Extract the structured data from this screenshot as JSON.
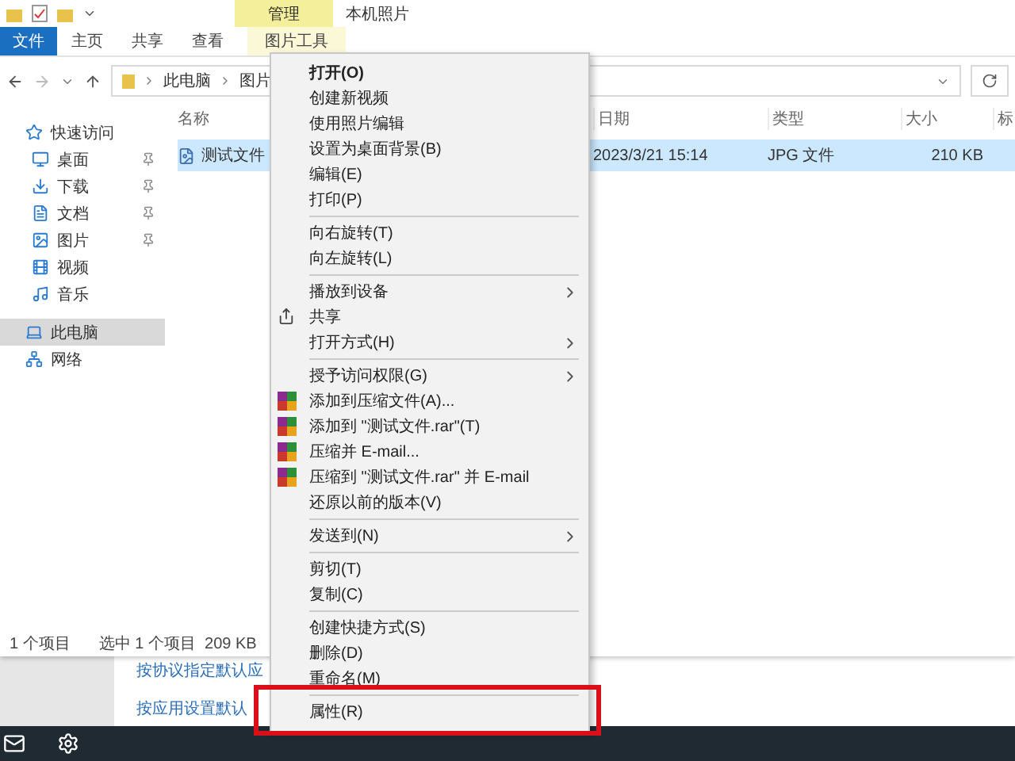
{
  "title_bar": {
    "context_tab": "管理",
    "title": "本机照片"
  },
  "ribbon_tabs": [
    {
      "label": "文件",
      "kind": "file"
    },
    {
      "label": "主页",
      "kind": "tab"
    },
    {
      "label": "共享",
      "kind": "tab"
    },
    {
      "label": "查看",
      "kind": "tab"
    },
    {
      "label": "图片工具",
      "kind": "context"
    }
  ],
  "address_bar": {
    "breadcrumb": [
      "此电脑",
      "图片"
    ]
  },
  "sidebar": {
    "items": [
      {
        "label": "快速访问",
        "kind": "star",
        "selected": false,
        "children": [
          {
            "label": "桌面",
            "kind": "desktop",
            "pinned": true,
            "selected": false
          },
          {
            "label": "下载",
            "kind": "download",
            "pinned": true,
            "selected": false
          },
          {
            "label": "文档",
            "kind": "documents",
            "pinned": true,
            "selected": false
          },
          {
            "label": "图片",
            "kind": "pictures",
            "pinned": true,
            "selected": false
          },
          {
            "label": "视频",
            "kind": "videos",
            "pinned": false,
            "selected": false
          },
          {
            "label": "音乐",
            "kind": "music",
            "pinned": false,
            "selected": false
          }
        ]
      },
      {
        "label": "此电脑",
        "kind": "pc",
        "selected": true
      },
      {
        "label": "网络",
        "kind": "network",
        "selected": false
      }
    ]
  },
  "table": {
    "columns": [
      "名称",
      "日期",
      "类型",
      "大小",
      "标"
    ],
    "rows": [
      {
        "name": "测试文件",
        "date": "2023/3/21 15:14",
        "type": "JPG 文件",
        "size": "210 KB",
        "selected": true
      }
    ]
  },
  "status_bar": {
    "count": "1 个项目",
    "selection": "选中 1 个项目  209 KB"
  },
  "background_links": [
    "按协议指定默认应",
    "按应用设置默认"
  ],
  "context_menu": {
    "groups": [
      [
        {
          "label": "打开(O)",
          "kind": "plain",
          "bold": true
        },
        {
          "label": "创建新视频",
          "kind": "plain",
          "bold": false
        },
        {
          "label": "使用照片编辑",
          "kind": "plain",
          "bold": false
        },
        {
          "label": "设置为桌面背景(B)",
          "kind": "plain",
          "bold": false
        },
        {
          "label": "编辑(E)",
          "kind": "plain",
          "bold": false
        },
        {
          "label": "打印(P)",
          "kind": "plain",
          "bold": false
        }
      ],
      [
        {
          "label": "向右旋转(T)",
          "kind": "plain",
          "bold": false
        },
        {
          "label": "向左旋转(L)",
          "kind": "plain",
          "bold": false
        }
      ],
      [
        {
          "label": "播放到设备",
          "kind": "submenu",
          "bold": false
        },
        {
          "label": "共享",
          "kind": "share",
          "bold": false
        },
        {
          "label": "打开方式(H)",
          "kind": "submenu",
          "bold": false
        }
      ],
      [
        {
          "label": "授予访问权限(G)",
          "kind": "submenu",
          "bold": false
        },
        {
          "label": "添加到压缩文件(A)...",
          "kind": "archive",
          "bold": false
        },
        {
          "label": "添加到 \"测试文件.rar\"(T)",
          "kind": "archive",
          "bold": false
        },
        {
          "label": "压缩并 E-mail...",
          "kind": "archive",
          "bold": false
        },
        {
          "label": "压缩到 \"测试文件.rar\" 并 E-mail",
          "kind": "archive",
          "bold": false
        },
        {
          "label": "还原以前的版本(V)",
          "kind": "plain",
          "bold": false
        }
      ],
      [
        {
          "label": "发送到(N)",
          "kind": "submenu",
          "bold": false
        }
      ],
      [
        {
          "label": "剪切(T)",
          "kind": "plain",
          "bold": false
        },
        {
          "label": "复制(C)",
          "kind": "plain",
          "bold": false
        }
      ],
      [
        {
          "label": "创建快捷方式(S)",
          "kind": "plain",
          "bold": false
        },
        {
          "label": "删除(D)",
          "kind": "plain",
          "bold": false
        },
        {
          "label": "重命名(M)",
          "kind": "plain",
          "bold": false
        }
      ],
      [
        {
          "label": "属性(R)",
          "kind": "plain",
          "bold": false,
          "annotated": true
        }
      ]
    ]
  }
}
